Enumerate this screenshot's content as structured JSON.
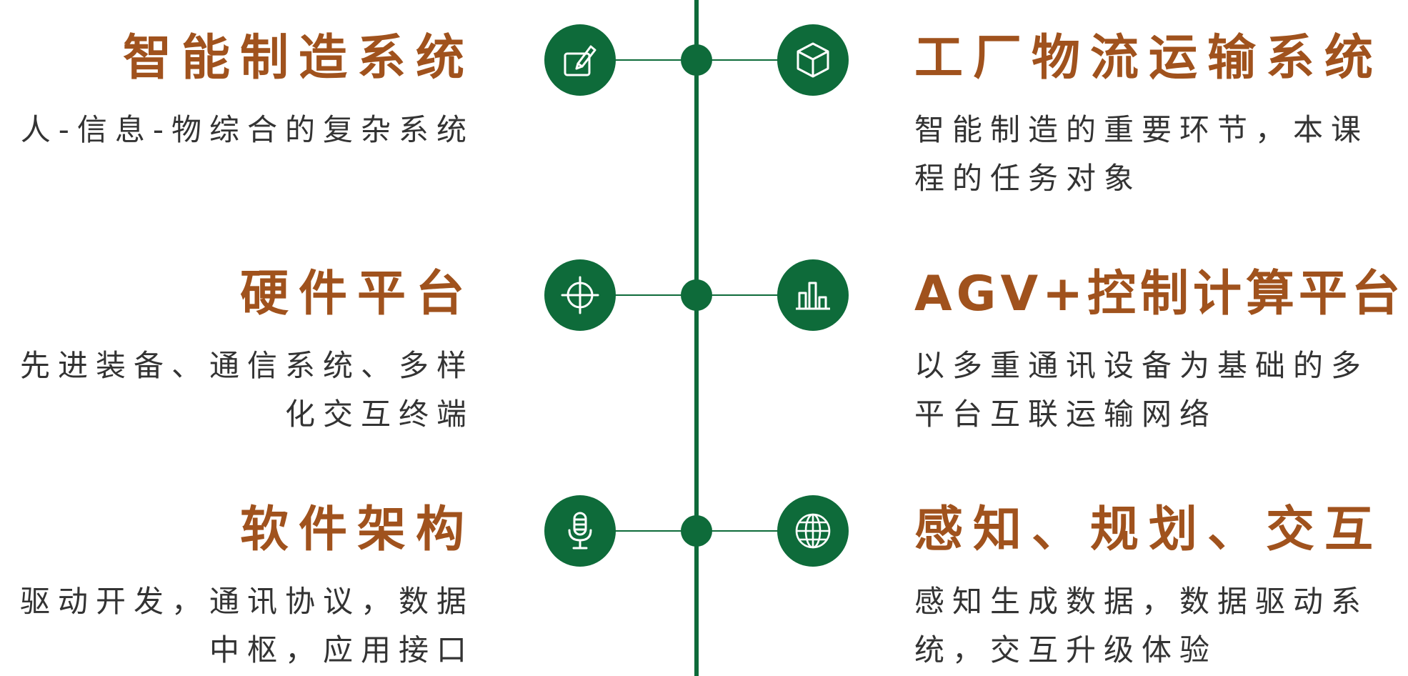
{
  "colors": {
    "accent_green": "#0e6b3a",
    "title_brown": "#a0521d",
    "body_text": "#333333"
  },
  "rows": [
    {
      "left": {
        "title": "智能制造系统",
        "desc": "人-信息-物综合的复杂系统",
        "icon": "pen-tablet-icon"
      },
      "right": {
        "title": "工厂物流运输系统",
        "desc": "智能制造的重要环节，本课程的任务对象",
        "icon": "cube-icon"
      }
    },
    {
      "left": {
        "title": "硬件平台",
        "desc": "先进装备、通信系统、多样化交互终端",
        "icon": "crosshair-icon"
      },
      "right": {
        "title": "AGV+控制计算平台",
        "desc": "以多重通讯设备为基础的多平台互联运输网络",
        "icon": "bar-chart-icon"
      }
    },
    {
      "left": {
        "title": "软件架构",
        "desc": "驱动开发，通讯协议，数据中枢，应用接口",
        "icon": "microphone-icon"
      },
      "right": {
        "title": "感知、规划、交互",
        "desc": "感知生成数据，数据驱动系统，交互升级体验",
        "icon": "globe-icon"
      }
    }
  ]
}
